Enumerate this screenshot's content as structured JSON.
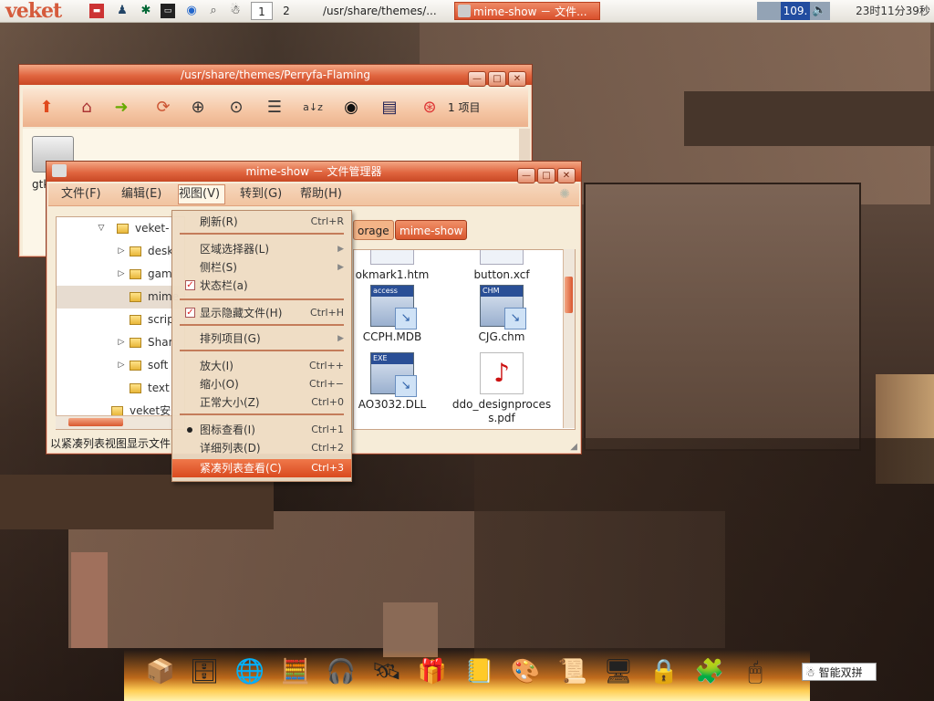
{
  "panel": {
    "logo": "veket",
    "workspaces": [
      "1",
      "2"
    ],
    "tasks": [
      "/usr/share/themes/...",
      "mime-show － 文件..."
    ],
    "volume": "109.",
    "clock": "23时11分39秒"
  },
  "win1": {
    "title": "/usr/share/themes/Perryfa-Flaming",
    "item_count": "1 项目",
    "folder_label": "gtk"
  },
  "win2": {
    "title": "mime-show － 文件管理器",
    "menu": [
      "文件(F)",
      "编辑(E)",
      "视图(V)",
      "转到(G)",
      "帮助(H)"
    ],
    "path_buttons": [
      "orage",
      "mime-show"
    ],
    "tree": [
      {
        "label": "veket-",
        "exp": "▽"
      },
      {
        "label": "desk",
        "exp": "▷"
      },
      {
        "label": "gam",
        "exp": "▷"
      },
      {
        "label": "mime",
        "exp": ""
      },
      {
        "label": "scrip",
        "exp": ""
      },
      {
        "label": "Shar",
        "exp": "▷"
      },
      {
        "label": "soft",
        "exp": "▷"
      },
      {
        "label": "text",
        "exp": ""
      },
      {
        "label": "veket安",
        "exp": ""
      }
    ],
    "files": [
      {
        "name": "okmark1.htm"
      },
      {
        "name": "button.xcf"
      },
      {
        "name": "CCPH.MDB",
        "badge": "access"
      },
      {
        "name": "CJG.chm",
        "badge": "CHM"
      },
      {
        "name": "AO3032.DLL",
        "badge": "EXE"
      },
      {
        "name": "ddo_designproces s.pdf"
      }
    ],
    "status": "以紧凑列表视图显示文件"
  },
  "view_menu": {
    "items": [
      {
        "label": "刷新(R)",
        "acc": "Ctrl+R"
      },
      {
        "label": "区域选择器(L)",
        "sub": "▶"
      },
      {
        "label": "侧栏(S)",
        "sub": "▶"
      },
      {
        "label": "状态栏(a)",
        "checked": true
      },
      {
        "label": "显示隐藏文件(H)",
        "acc": "Ctrl+H",
        "checked": true
      },
      {
        "label": "排列项目(G)",
        "sub": "▶"
      },
      {
        "label": "放大(I)",
        "acc": "Ctrl++"
      },
      {
        "label": "缩小(O)",
        "acc": "Ctrl+−"
      },
      {
        "label": "正常大小(Z)",
        "acc": "Ctrl+0"
      },
      {
        "label": "图标查看(I)",
        "acc": "Ctrl+1",
        "radio": true
      },
      {
        "label": "详细列表(D)",
        "acc": "Ctrl+2"
      },
      {
        "label": "紧凑列表查看(C)",
        "acc": "Ctrl+3",
        "highlighted": true
      }
    ]
  },
  "ime": "智能双拼"
}
